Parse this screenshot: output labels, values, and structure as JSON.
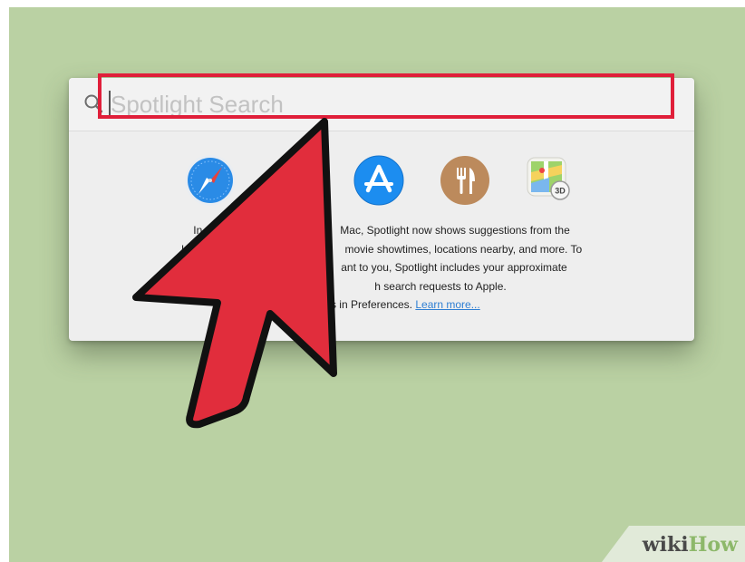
{
  "spotlight": {
    "search": {
      "placeholder": "Spotlight Search",
      "value": ""
    },
    "suggestions": [
      {
        "icon": "safari-icon"
      },
      {
        "icon": "app-store-icon"
      },
      {
        "icon": "restaurant-icon"
      },
      {
        "icon": "maps-icon"
      }
    ],
    "info": {
      "lines": [
        "In additi",
        "Mac, Spotlight now shows suggestions from the",
        "Intern",
        "movie showtimes, locations nearby, and more. To",
        "ant to you, Spotlight includes your approximate",
        "h search requests to Apple.",
        "this in Preferences."
      ],
      "link_label": "Learn more..."
    }
  },
  "watermark": {
    "wiki": "wiki",
    "how": "How"
  },
  "colors": {
    "background": "#bad1a3",
    "highlight": "#e01f3a",
    "arrow": "#e12d3c",
    "link": "#2f7fd3"
  }
}
